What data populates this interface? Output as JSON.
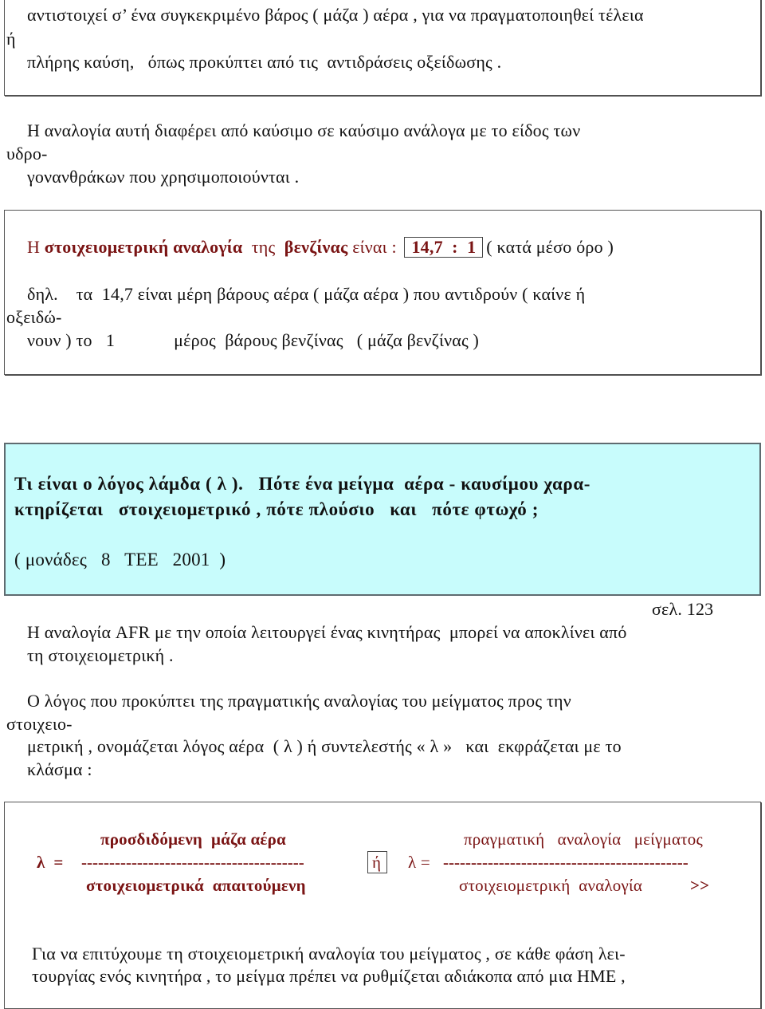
{
  "intro_box": {
    "line1": "αντιστοιχεί σ’ ένα συγκεκριμένο βάρος ( μάζα ) αέρα , για να πραγματοποιηθεί τέλεια",
    "line2": "ή",
    "line3": "πλήρης καύση,   όπως προκύπτει από τις  αντιδράσεις οξείδωσης ."
  },
  "fuel_paragraph": {
    "line1": "Η αναλογία αυτή διαφέρει από καύσιμο σε καύσιμο ανάλογα με το είδος των",
    "line2": "υδρο-",
    "line3": "γονανθράκων που χρησιμοποιούνται ."
  },
  "stoich_box": {
    "prefix": "Η ",
    "term1": "στοιχειομετρική αναλογία",
    "middle": "  της  ",
    "term2": "βενζίνας",
    "suffix": " είναι : ",
    "ratio": "14,7  :  1",
    "average_note": "( κατά μέσο όρο )",
    "explain_line1": "δηλ.    τα  14,7 είναι μέρη βάρους αέρα ( μάζα αέρα ) που αντιδρούν ( καίνε ή",
    "explain_line2": "οξειδώ-",
    "explain_line3": "νουν ) το   1             μέρος  βάρους βενζίνας   ( μάζα βενζίνας )"
  },
  "question_box": {
    "line1": "Τι είναι ο λόγος λάμδα ( λ ).   Πότε ένα μείγμα  αέρα - καυσίμου χαρα-",
    "line2": "κτηρίζεται   στοιχειομετρικό , πότε πλούσιο   και   πότε φτωχό ;",
    "line3": "( μονάδες   8   ΤΕΕ   2001  )",
    "background": "#c8fcfc"
  },
  "page_ref": "σελ. 123",
  "afr_paragraph": {
    "line1": "Η αναλογία AFR με την οποία λειτουργεί ένας κινητήρας  μπορεί να αποκλίνει από",
    "line2": "τη στοιχειομετρική ."
  },
  "lambda_paragraph": {
    "line1": "Ο λόγος που προκύπτει της πραγματικής αναλογίας του μείγματος προς την",
    "line2": "στοιχειο-",
    "line3": "μετρική , ονομάζεται λόγος αέρα  ( λ ) ή συντελεστής « λ »   και  εκφράζεται με το",
    "line4": "κλάσμα :"
  },
  "formula_box": {
    "left_numerator": "προσδιδόμενη  μάζα αέρα",
    "left_lhs": "λ  =",
    "left_dashes": "----------------------------------------",
    "left_denominator": "στοιχειομετρικά  απαιτούμενη",
    "or_label": "ή",
    "right_numerator": "πραγματική   αναλογία   μείγματος",
    "right_lhs": "λ =",
    "right_dashes": "--------------------------------------------",
    "right_denominator": "στοιχειομετρική  αναλογία",
    "more_marker": ">>",
    "accent_color": "#7a1414",
    "closing_line1": "Για να επιτύχουμε τη στοιχειομετρική αναλογία του μείγματος , σε κάθε φάση λει-",
    "closing_line2": "τουργίας ενός κινητήρα , το μείγμα πρέπει να ρυθμίζεται αδιάκοπα από μια ΗΜΕ ,"
  }
}
